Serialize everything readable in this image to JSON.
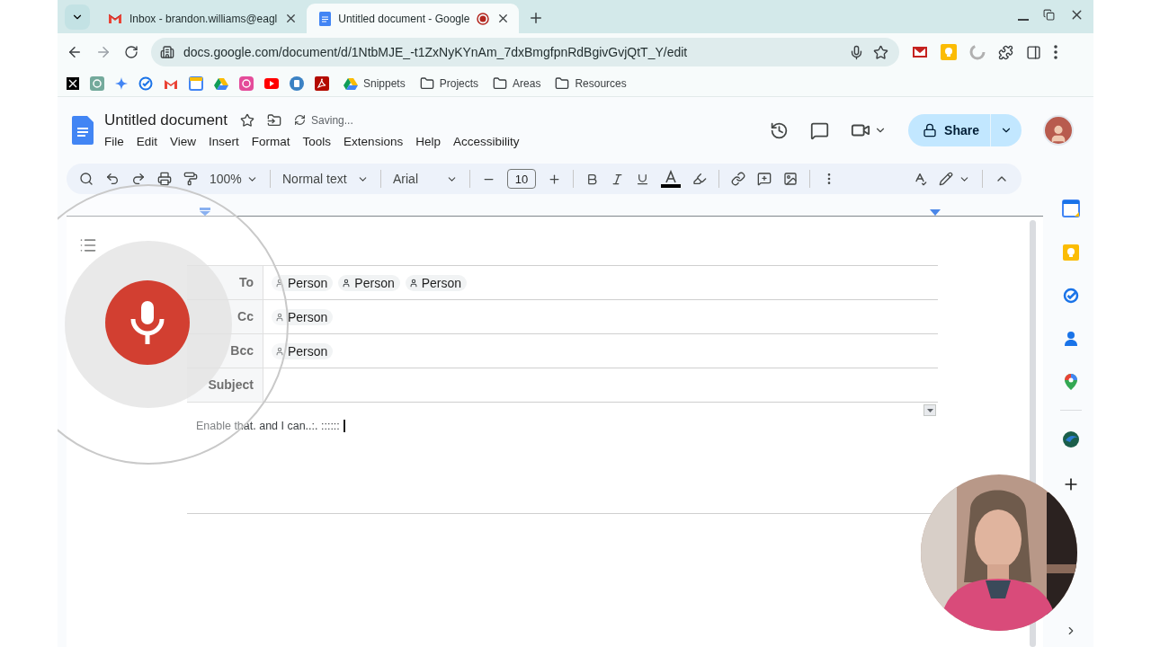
{
  "browser": {
    "tabs": [
      {
        "title": "Inbox - brandon.williams@eagl",
        "kind": "mail",
        "selected": false,
        "recording": false
      },
      {
        "title": "Untitled document - Google",
        "kind": "docs",
        "selected": true,
        "recording": true
      }
    ],
    "url": "docs.google.com/document/d/1NtbMJE_-t1ZxNyKYnAm_7dxBmgfpnRdBgivGvjQtT_Y/edit",
    "bookmarks": [
      {
        "label": "Snippets",
        "kind": "drive"
      },
      {
        "label": "Projects",
        "kind": "folder"
      },
      {
        "label": "Areas",
        "kind": "folder"
      },
      {
        "label": "Resources",
        "kind": "folder"
      }
    ]
  },
  "docs": {
    "title": "Untitled document",
    "status": "Saving...",
    "menu": [
      "File",
      "Edit",
      "View",
      "Insert",
      "Format",
      "Tools",
      "Extensions",
      "Help",
      "Accessibility"
    ],
    "zoom": "100%",
    "style": "Normal text",
    "font": "Arial",
    "font_size": "10",
    "share": "Share"
  },
  "email": {
    "fields": [
      {
        "label": "To",
        "chips": [
          "Person",
          "Person",
          "Person"
        ]
      },
      {
        "label": "Cc",
        "chips": [
          "Person"
        ]
      },
      {
        "label": "Bcc",
        "chips": [
          "Person"
        ]
      },
      {
        "label": "Subject"
      }
    ],
    "body": "Enable that. and I can..:. ::::::"
  }
}
